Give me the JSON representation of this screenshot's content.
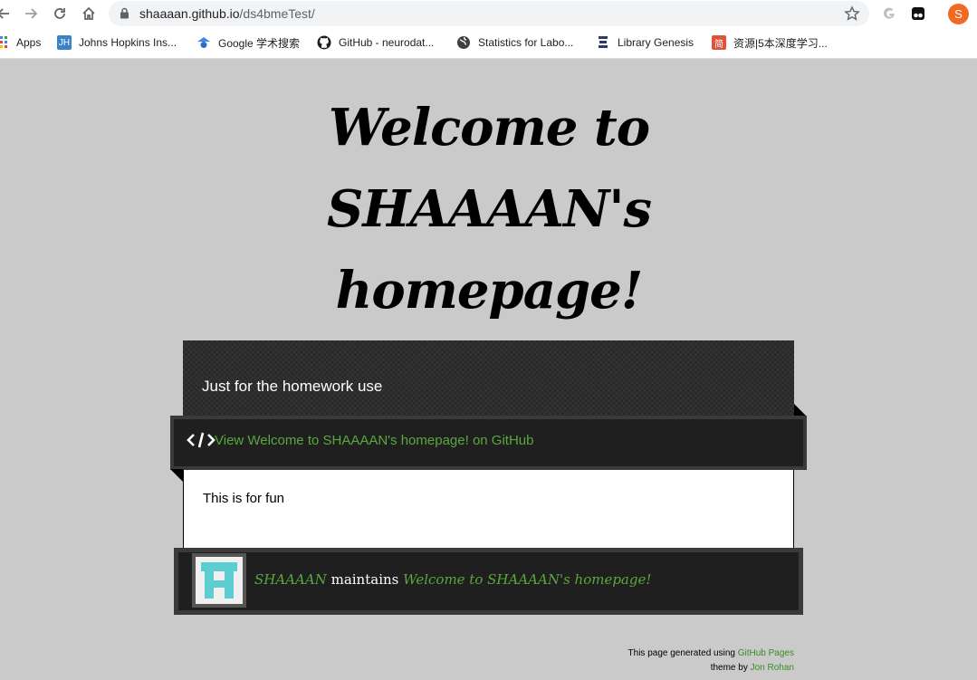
{
  "browser": {
    "url_host": "shaaaan.github.io",
    "url_path": "/ds4bmeTest/",
    "profile_initial": "S",
    "bookmarks": [
      {
        "label": "Apps",
        "icon": "apps-grid-icon"
      },
      {
        "label": "Johns Hopkins Ins...",
        "icon": "jh-icon",
        "fav_text": "JH"
      },
      {
        "label": "Google 学术搜索",
        "icon": "scholar-icon"
      },
      {
        "label": "GitHub - neurodat...",
        "icon": "github-icon"
      },
      {
        "label": "Statistics for Labo...",
        "icon": "globe-icon"
      },
      {
        "label": "Library Genesis",
        "icon": "library-icon"
      },
      {
        "label": "资源|5本深度学习...",
        "icon": "jian-icon",
        "fav_text": "简"
      }
    ]
  },
  "page": {
    "title": "Welcome to SHAAAAN's homepage!",
    "tagline": "Just for the homework use",
    "repo_link": "View Welcome to SHAAAAN's homepage! on GitHub",
    "body_text": "This is for fun",
    "maintainer": {
      "name": "SHAAAAN",
      "verb": "maintains",
      "project": "Welcome to SHAAAAN's homepage!"
    },
    "credits": {
      "line1_prefix": "This page generated using",
      "line1_link": "GitHub Pages",
      "line2_prefix": "theme by",
      "line2_link": "Jon Rohan"
    }
  },
  "colors": {
    "background": "#cacaca",
    "band": "#262626",
    "link_green": "#59a83d",
    "avatar_teal": "#5ccdd0"
  }
}
